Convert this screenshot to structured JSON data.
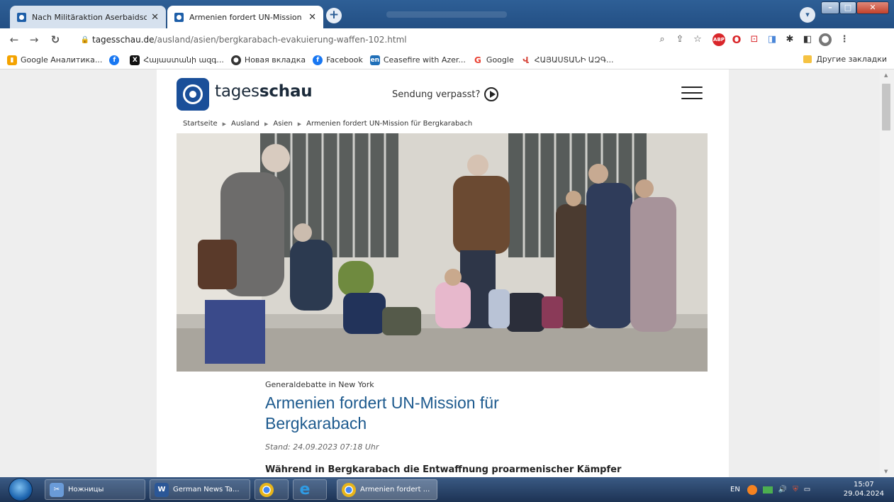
{
  "browser": {
    "tabs": [
      {
        "title": "Nach Militäraktion Aserbaidscha",
        "close": "✕"
      },
      {
        "title": "Armenien fordert UN-Mission fü",
        "close": "✕"
      }
    ],
    "new_tab": "+",
    "url_domain": "tagesschau.de",
    "url_path": "/ausland/asien/bergkarabach-evakuierung-waffen-102.html",
    "bookmarks": [
      {
        "label": "Google Аналитика...",
        "icon": "analytics-icon",
        "color": "#f4a300"
      },
      {
        "label": "",
        "icon": "facebook-icon",
        "color": "#1877f2"
      },
      {
        "label": "Հայաստանի ազգ...",
        "icon": "x-icon",
        "color": "#111111"
      },
      {
        "label": "Новая вкладка",
        "icon": "chrome-icon",
        "color": "#333333"
      },
      {
        "label": "Facebook",
        "icon": "facebook-icon",
        "color": "#1877f2"
      },
      {
        "label": "Ceasefire with Azer...",
        "icon": "en-icon",
        "color": "#1f6fb8"
      },
      {
        "label": "Google",
        "icon": "google-icon",
        "color": "#ea4335"
      },
      {
        "label": "ՀԱՅԱՍՏԱՆԻ ԱԶԳ...",
        "icon": "armenia-icon",
        "color": "#d6453a"
      }
    ],
    "other_bookmarks": "Другие закладки"
  },
  "site": {
    "brand_light": "tages",
    "brand_bold": "schau",
    "sendung": "Sendung verpasst?",
    "breadcrumb": [
      "Startseite",
      "Ausland",
      "Asien",
      "Armenien fordert UN-Mission für Bergkarabach"
    ]
  },
  "article": {
    "kicker": "Generaldebatte in New York",
    "headline": "Armenien fordert UN-Mission für Bergkarabach",
    "stand": "Stand: 24.09.2023 07:18 Uhr",
    "lead": "Während in Bergkarabach die Entwaffnung proarmenischer Kämpfer"
  },
  "taskbar": {
    "items": [
      {
        "label": "Ножницы",
        "icon": "scissors-icon",
        "color": "#6a9bd8"
      },
      {
        "label": "German News Ta...",
        "icon": "word-icon",
        "color": "#2b5797"
      },
      {
        "label": "",
        "icon": "chrome-icon",
        "color": "#e8b51a"
      },
      {
        "label": "",
        "icon": "ie-icon",
        "color": "#2f9be3"
      },
      {
        "label": "Armenien fordert ...",
        "icon": "chrome-icon",
        "color": "#e8b51a"
      }
    ],
    "lang": "EN",
    "time": "15:07",
    "date": "29.04.2024"
  }
}
